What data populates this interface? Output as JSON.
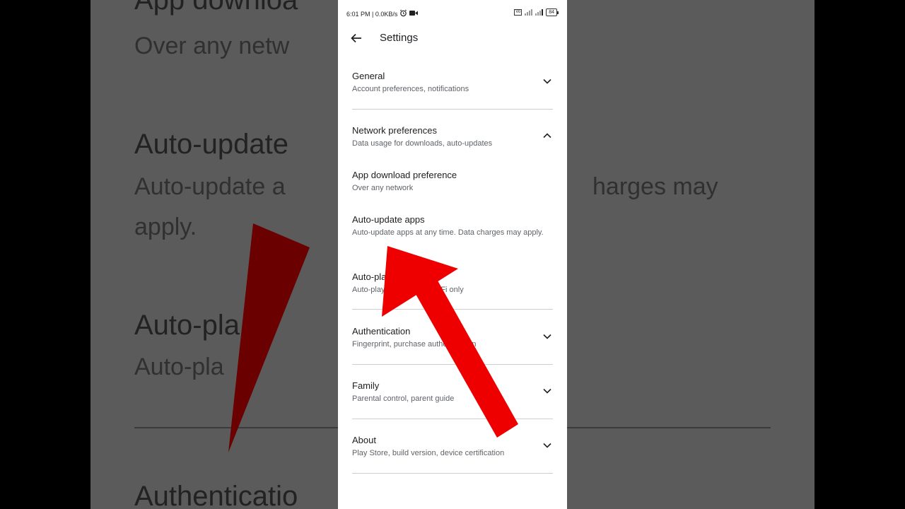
{
  "background_zoom": {
    "line1": "App downloa",
    "line2": "Over any netw",
    "line3": "Auto-update",
    "line4a": "Auto-update a",
    "line4b": "harges may",
    "line5": "apply.",
    "line6": "Auto-pla",
    "line7": "Auto-pla",
    "line8": "Authenticatio"
  },
  "status_bar": {
    "time_speed": "6:01 PM | 0.0KB/s",
    "network_badge": "Vo",
    "signal_badge": "4G",
    "battery": "84"
  },
  "app_bar": {
    "title": "Settings"
  },
  "sections": [
    {
      "title": "General",
      "subtitle": "Account preferences, notifications",
      "expanded": false
    },
    {
      "title": "Network preferences",
      "subtitle": "Data usage for downloads, auto-updates",
      "expanded": true
    },
    {
      "title": "Authentication",
      "subtitle": "Fingerprint, purchase authentication",
      "expanded": false
    },
    {
      "title": "Family",
      "subtitle": "Parental control, parent guide",
      "expanded": false
    },
    {
      "title": "About",
      "subtitle": "Play Store, build version, device certification",
      "expanded": false
    }
  ],
  "network_items": [
    {
      "title": "App download preference",
      "subtitle": "Over any network"
    },
    {
      "title": "Auto-update apps",
      "subtitle": "Auto-update apps at any time. Data charges may apply."
    },
    {
      "title": "Auto-play videos",
      "subtitle": "Auto-play videos over Wi-Fi only"
    }
  ],
  "colors": {
    "arrow": "#ee0000",
    "text_primary": "#202124",
    "text_secondary": "#5f6368"
  }
}
